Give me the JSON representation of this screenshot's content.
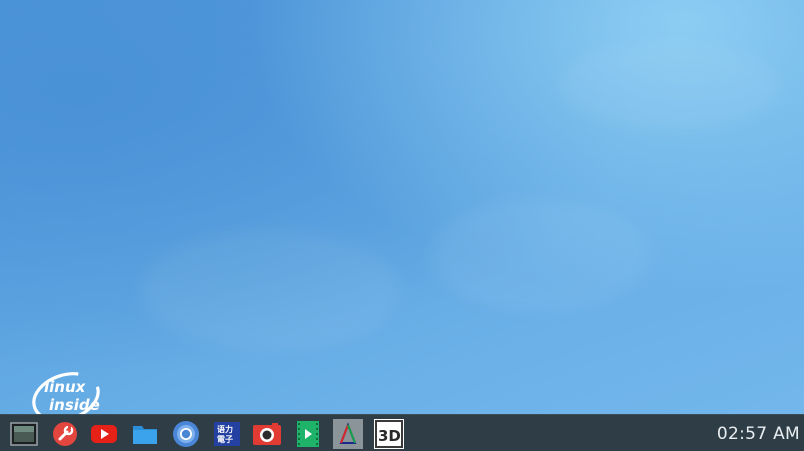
{
  "desktop": {
    "wallpaper": "sky-blue",
    "colors": {
      "sky_top": "#4c94d8",
      "sky_bright": "#8ccdf3",
      "taskbar": "#2f3e46"
    }
  },
  "badge": {
    "line1": "linux",
    "line2": "inside"
  },
  "taskbar": {
    "apps": [
      {
        "name": "start-menu-icon"
      },
      {
        "name": "tools-icon"
      },
      {
        "name": "youtube-icon"
      },
      {
        "name": "folder-icon"
      },
      {
        "name": "chromium-icon"
      },
      {
        "name": "dictionary-icon"
      },
      {
        "name": "camera-icon"
      },
      {
        "name": "video-player-icon"
      },
      {
        "name": "triangle-app-icon"
      },
      {
        "name": "3d-app-icon"
      }
    ],
    "clock": "02:57 AM"
  }
}
